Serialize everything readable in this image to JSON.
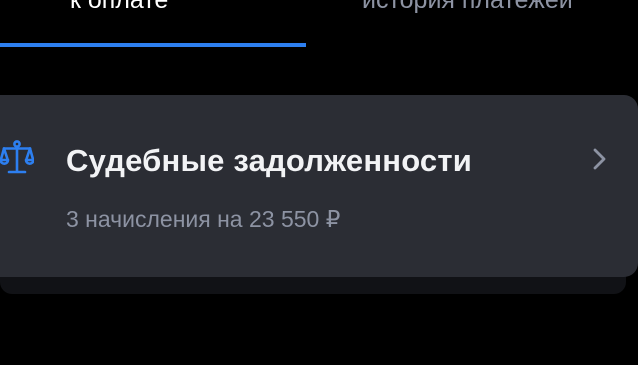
{
  "tabs": [
    {
      "label": "к оплате",
      "active": true
    },
    {
      "label": "история платежей",
      "active": false
    }
  ],
  "card": {
    "icon": "scales-icon",
    "title": "Судебные задолженности",
    "subtitle": "3 начисления на 23 550 ₽",
    "chevron": "chevron-right-icon"
  },
  "colors": {
    "background": "#000000",
    "card": "#2b2d34",
    "accent": "#2d7ff0",
    "text_primary": "#f2f3f5",
    "text_secondary": "#8d93a3"
  }
}
